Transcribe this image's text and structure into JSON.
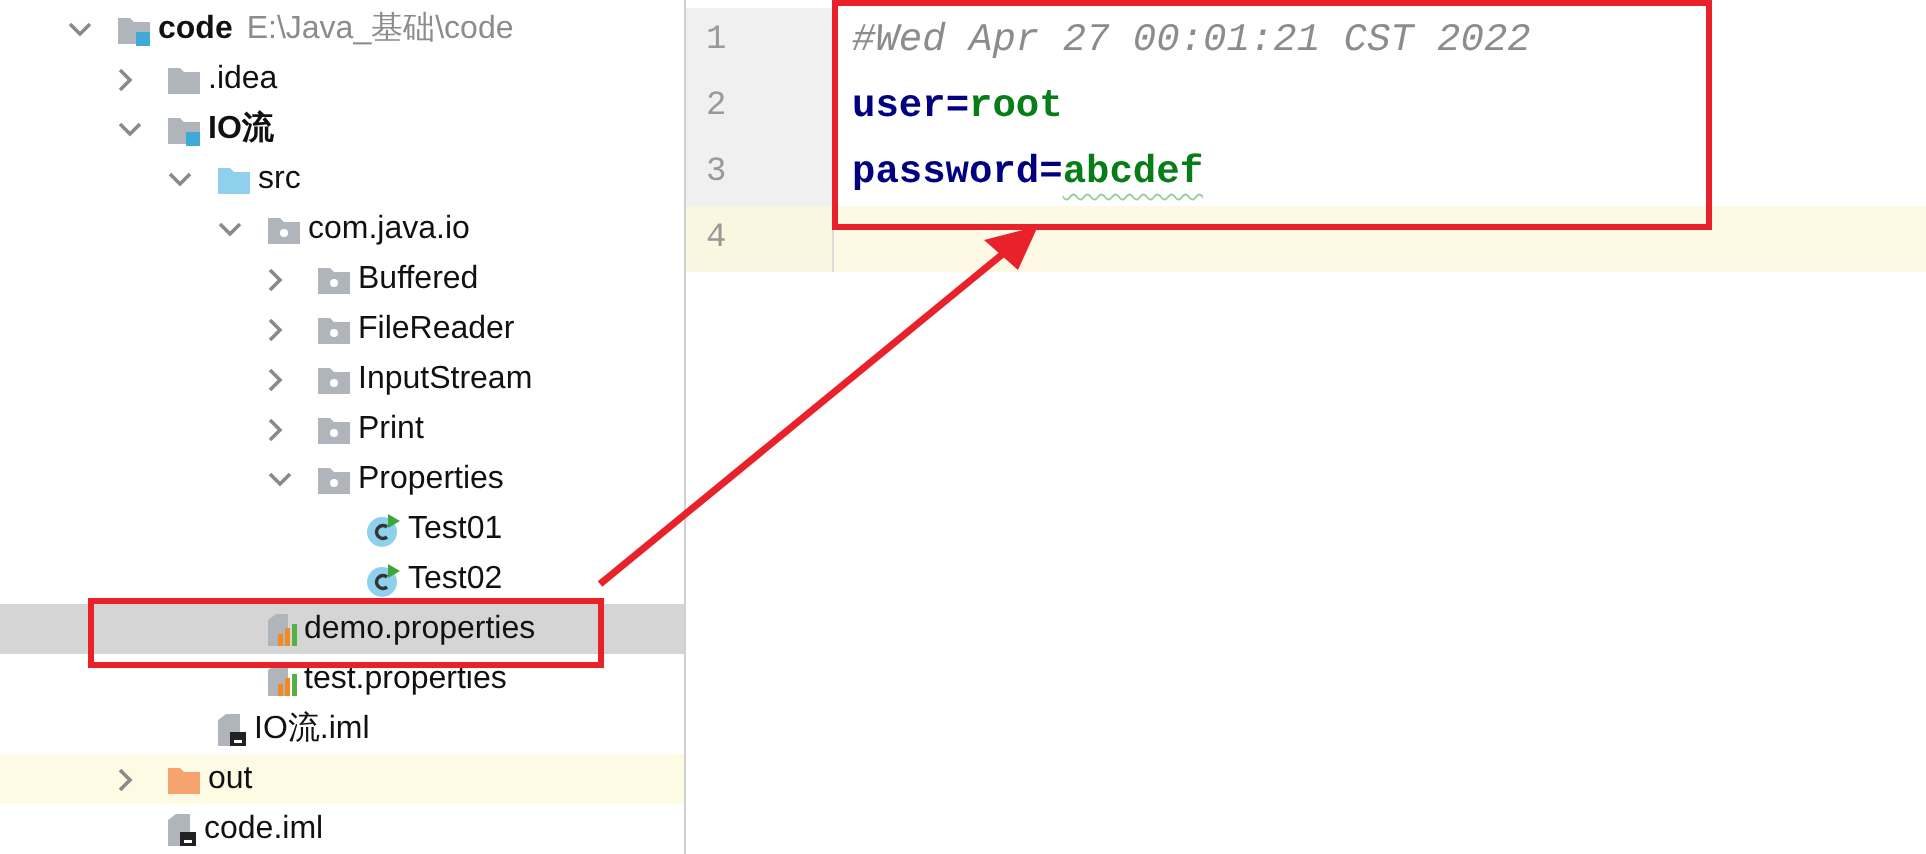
{
  "project_tree": [
    {
      "label": "code",
      "path": "E:\\Java_基础\\code",
      "kind": "module",
      "expanded": true,
      "selected": false,
      "children": [
        {
          "label": ".idea",
          "kind": "folder",
          "expanded": false,
          "selected": false
        },
        {
          "label": "IO流",
          "kind": "module",
          "expanded": true,
          "selected": false,
          "children": [
            {
              "label": "src",
              "kind": "source",
              "expanded": true,
              "selected": false,
              "children": [
                {
                  "label": "com.java.io",
                  "kind": "package",
                  "expanded": true,
                  "selected": false,
                  "children": [
                    {
                      "label": "Buffered",
                      "kind": "package",
                      "expanded": false,
                      "selected": false
                    },
                    {
                      "label": "FileReader",
                      "kind": "package",
                      "expanded": false,
                      "selected": false
                    },
                    {
                      "label": "InputStream",
                      "kind": "package",
                      "expanded": false,
                      "selected": false
                    },
                    {
                      "label": "Print",
                      "kind": "package",
                      "expanded": false,
                      "selected": false
                    },
                    {
                      "label": "Properties",
                      "kind": "package",
                      "expanded": true,
                      "selected": false,
                      "children": [
                        {
                          "label": "Test01",
                          "kind": "class",
                          "selected": false
                        },
                        {
                          "label": "Test02",
                          "kind": "class",
                          "selected": false
                        }
                      ]
                    }
                  ]
                },
                {
                  "label": "demo.properties",
                  "kind": "properties",
                  "selected": true,
                  "annotated": true
                },
                {
                  "label": "test.properties",
                  "kind": "properties",
                  "selected": false
                }
              ]
            },
            {
              "label": "IO流.iml",
              "kind": "iml",
              "selected": false
            }
          ]
        },
        {
          "label": "out",
          "kind": "excluded",
          "expanded": false,
          "selected": false
        },
        {
          "label": "code.iml",
          "kind": "iml",
          "selected": false
        }
      ]
    }
  ],
  "editor": {
    "annotated": true,
    "lines": [
      {
        "number": "1",
        "current": false,
        "tokens": [
          {
            "text": "#Wed Apr 27 00:01:21 CST 2022",
            "kind": "comment"
          }
        ]
      },
      {
        "number": "2",
        "current": false,
        "tokens": [
          {
            "text": "user",
            "kind": "key"
          },
          {
            "text": "=",
            "kind": "op"
          },
          {
            "text": "root",
            "kind": "value"
          }
        ]
      },
      {
        "number": "3",
        "current": false,
        "tokens": [
          {
            "text": "password",
            "kind": "key"
          },
          {
            "text": "=",
            "kind": "op"
          },
          {
            "text": "abcdef",
            "kind": "value",
            "typo": true
          }
        ]
      },
      {
        "number": "4",
        "current": true
      }
    ]
  },
  "annotation": {
    "kind": "arrow",
    "color": "#e8212b"
  }
}
